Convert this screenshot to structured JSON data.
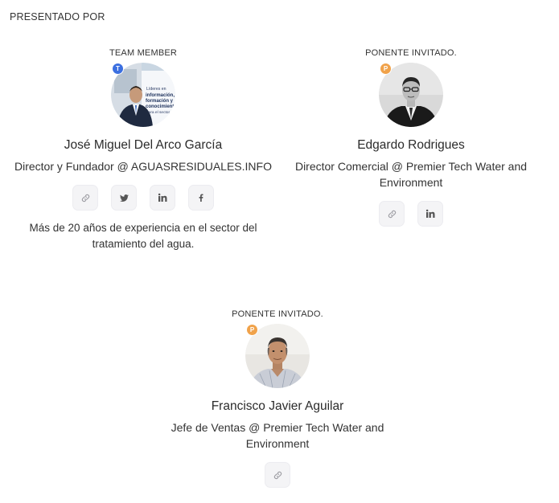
{
  "section": {
    "title": "PRESENTADO POR"
  },
  "speakers": [
    {
      "role": "TEAM MEMBER",
      "badge": "T",
      "name": "José Miguel Del Arco García",
      "title": "Director y Fundador @ AGUASRESIDUALES.INFO",
      "links": [
        "link-icon",
        "twitter-icon",
        "linkedin-icon",
        "facebook-icon"
      ],
      "bio": "Más de 20 años de experiencia en el sector del tratamiento del agua.",
      "avatar_bg_text": [
        "Líderes en",
        "información,",
        "formación y",
        "conocimiento",
        "para el sector"
      ]
    },
    {
      "role": "PONENTE INVITADO.",
      "badge": "P",
      "name": "Edgardo Rodrigues",
      "title": "Director Comercial @ Premier Tech Water and Environment",
      "links": [
        "link-icon",
        "linkedin-icon"
      ]
    },
    {
      "role": "PONENTE INVITADO.",
      "badge": "P",
      "name": "Francisco Javier Aguilar",
      "title": "Jefe de Ventas @ Premier Tech Water and Environment",
      "links": [
        "link-icon"
      ]
    }
  ],
  "colors": {
    "badge_team": "#3b6fe0",
    "badge_guest": "#f0a24a",
    "icon": "#555555",
    "button_bg": "#f4f4f6"
  }
}
